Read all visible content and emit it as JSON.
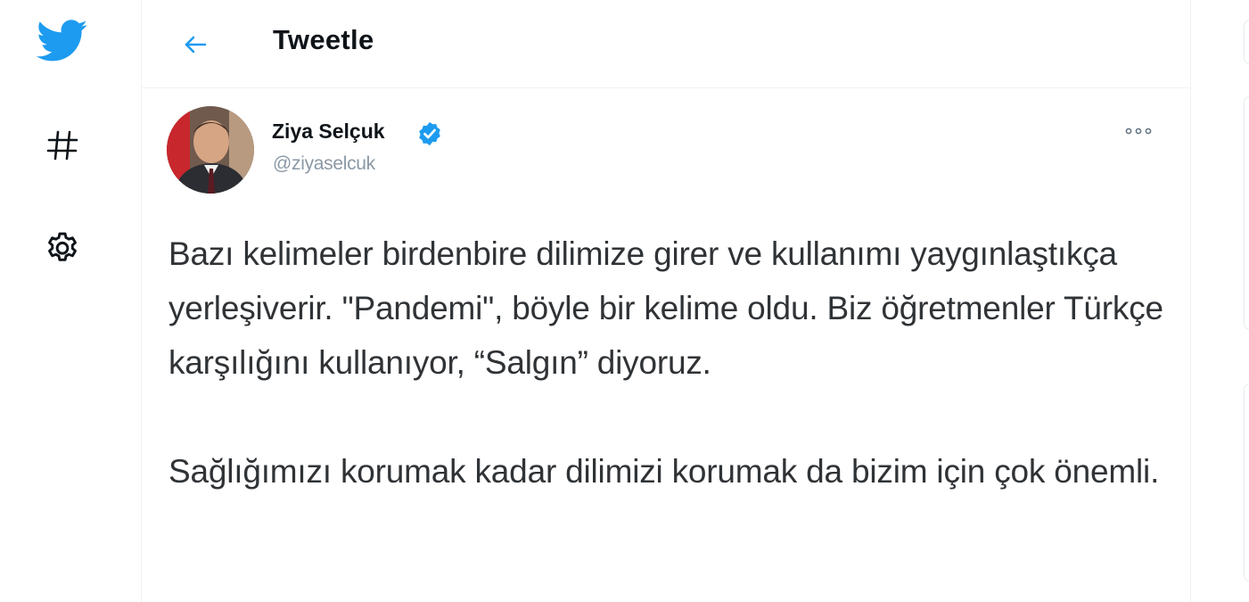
{
  "nav": {
    "logo_icon": "twitter-bird-icon",
    "explore_icon": "hashtag-icon",
    "settings_icon": "gear-icon"
  },
  "header": {
    "back_icon": "arrow-left-icon",
    "title": "Tweetle"
  },
  "tweet": {
    "author": {
      "name": "Ziya Selçuk",
      "handle": "@ziyaselcuk",
      "verified_icon": "verified-badge-icon"
    },
    "more_icon": "more-dots-icon",
    "paragraphs": [
      "Bazı kelimeler birdenbire dilimize girer ve kullanımı yaygınlaştıkça yerleşiverir. \"Pandemi\", böyle bir kelime oldu. Biz öğretmenler Türkçe karşılığını kullanıyor, “Salgın” diyoruz.",
      "Sağlığımızı korumak kadar dilimizi korumak da bizim için çok önemli."
    ]
  },
  "colors": {
    "brand": "#1d9bf0",
    "text": "#303336",
    "secondary": "#8b98a5",
    "border": "#eff3f4"
  }
}
